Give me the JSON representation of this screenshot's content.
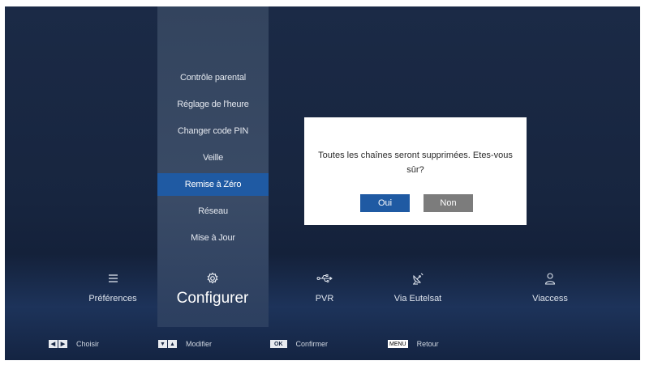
{
  "menu": {
    "items": [
      {
        "label": "Contrôle parental"
      },
      {
        "label": "Réglage de l'heure"
      },
      {
        "label": "Changer code PIN"
      },
      {
        "label": "Veille"
      },
      {
        "label": "Remise à Zéro"
      },
      {
        "label": "Réseau"
      },
      {
        "label": "Mise à Jour"
      }
    ],
    "selected_index": 4
  },
  "dialog": {
    "message_line1": "Toutes les chaînes  seront supprimées. Etes-vous",
    "message_line2": "sûr?",
    "yes_label": "Oui",
    "no_label": "Non"
  },
  "categories": [
    {
      "label": "Préférences",
      "icon": "list-icon"
    },
    {
      "label": "Configurer",
      "icon": "gear-icon"
    },
    {
      "label": "PVR",
      "icon": "usb-icon"
    },
    {
      "label": "Via Eutelsat",
      "icon": "satellite-icon"
    },
    {
      "label": "Viaccess",
      "icon": "user-icon"
    }
  ],
  "footer": {
    "choose_label": "Choisir",
    "modify_label": "Modifier",
    "ok_key": "OK",
    "confirm_label": "Confirmer",
    "menu_key": "MENU",
    "back_label": "Retour"
  },
  "colors": {
    "accent": "#1f5aa3",
    "background": "#17253f",
    "menu_column": "#3a4b66",
    "no_button": "#7c7c7c"
  }
}
